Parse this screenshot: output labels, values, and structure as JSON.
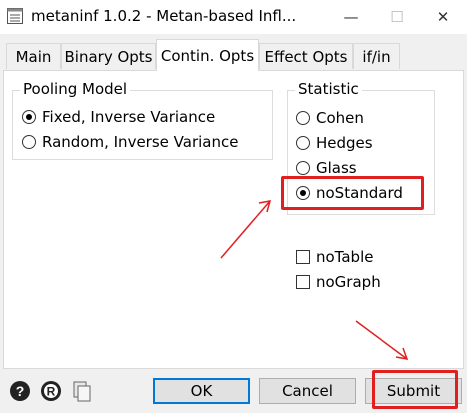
{
  "window": {
    "title": "metaninf 1.0.2 - Metan-based Infl...",
    "minimize_glyph": "—",
    "maximize_glyph": "☐",
    "close_glyph": "✕"
  },
  "tabs": [
    {
      "label": "Main"
    },
    {
      "label": "Binary Opts"
    },
    {
      "label": "Contin. Opts"
    },
    {
      "label": "Effect Opts"
    },
    {
      "label": "if/in"
    }
  ],
  "active_tab": "Contin. Opts",
  "pooling": {
    "legend": "Pooling Model",
    "options": [
      "Fixed, Inverse Variance",
      "Random, Inverse Variance"
    ],
    "selected": "Fixed, Inverse Variance"
  },
  "statistic": {
    "legend": "Statistic",
    "options": [
      "Cohen",
      "Hedges",
      "Glass",
      "noStandard"
    ],
    "selected": "noStandard"
  },
  "checkboxes": [
    {
      "label": "noTable",
      "checked": false
    },
    {
      "label": "noGraph",
      "checked": false
    }
  ],
  "buttons": {
    "help": "?",
    "reset": "R",
    "ok": "OK",
    "cancel": "Cancel",
    "submit": "Submit"
  },
  "annotation_color": "#e02020",
  "icons": [
    "window-app-icon",
    "help-icon",
    "reset-icon",
    "copy-icon"
  ]
}
